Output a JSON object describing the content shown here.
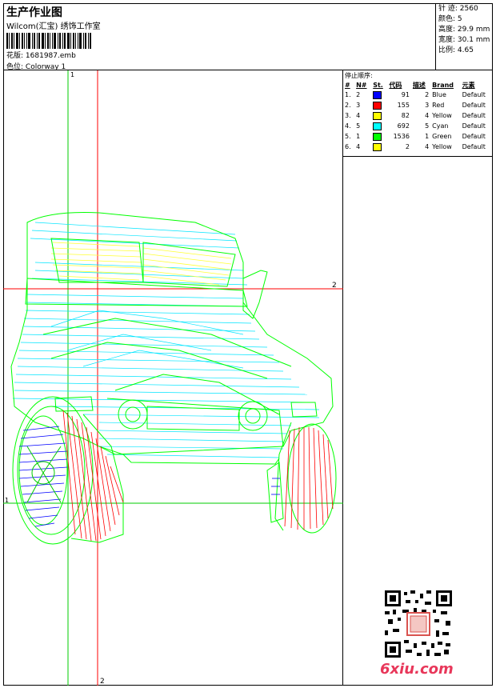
{
  "header": {
    "title": "生产作业图",
    "company": "Wilcom(汇宝) 绣饰工作室",
    "design_label": "花版:",
    "design_value": "1681987.emb",
    "colorway_label": "色位:",
    "colorway_value": "Colorway 1"
  },
  "stats": [
    {
      "label": "针 迹:",
      "value": "2560"
    },
    {
      "label": "颜色:",
      "value": "5"
    },
    {
      "label": "高度:",
      "value": "29.9 mm"
    },
    {
      "label": "宽度:",
      "value": "30.1 mm"
    },
    {
      "label": "比例:",
      "value": "4.65"
    }
  ],
  "stop_sequence": {
    "title": "停止顺序:",
    "columns": [
      "#",
      "N#",
      "St.",
      "代码",
      "描述",
      "Brand",
      "元素"
    ],
    "rows": [
      {
        "idx": "1.",
        "n": "2",
        "st": "91",
        "code": "2",
        "desc": "Blue",
        "brand": "Default",
        "color": "#0000ff"
      },
      {
        "idx": "2.",
        "n": "3",
        "st": "155",
        "code": "3",
        "desc": "Red",
        "brand": "Default",
        "color": "#ff0000"
      },
      {
        "idx": "3.",
        "n": "4",
        "st": "82",
        "code": "4",
        "desc": "Yellow",
        "brand": "Default",
        "color": "#ffff00"
      },
      {
        "idx": "4.",
        "n": "5",
        "st": "692",
        "code": "5",
        "desc": "Cyan",
        "brand": "Default",
        "color": "#00ffff"
      },
      {
        "idx": "5.",
        "n": "1",
        "st": "1536",
        "code": "1",
        "desc": "Green",
        "brand": "Default",
        "color": "#00ff00"
      },
      {
        "idx": "6.",
        "n": "4",
        "st": "2",
        "code": "4",
        "desc": "Yellow",
        "brand": "Default",
        "color": "#ffff00"
      }
    ]
  },
  "guides": {
    "h_top_label": "1",
    "v_bottom_label": "2",
    "h_mid_label": "2",
    "h_low_label": "1"
  },
  "watermark": {
    "site": "6xiu.com"
  },
  "colors": {
    "guide_green": "#00cc00",
    "guide_red": "#ff0000",
    "stitch_cyan": "#00e5ff",
    "stitch_green": "#00ff00",
    "stitch_yellow": "#ffff33",
    "stitch_red": "#ff0000",
    "stitch_blue": "#0000ff"
  }
}
